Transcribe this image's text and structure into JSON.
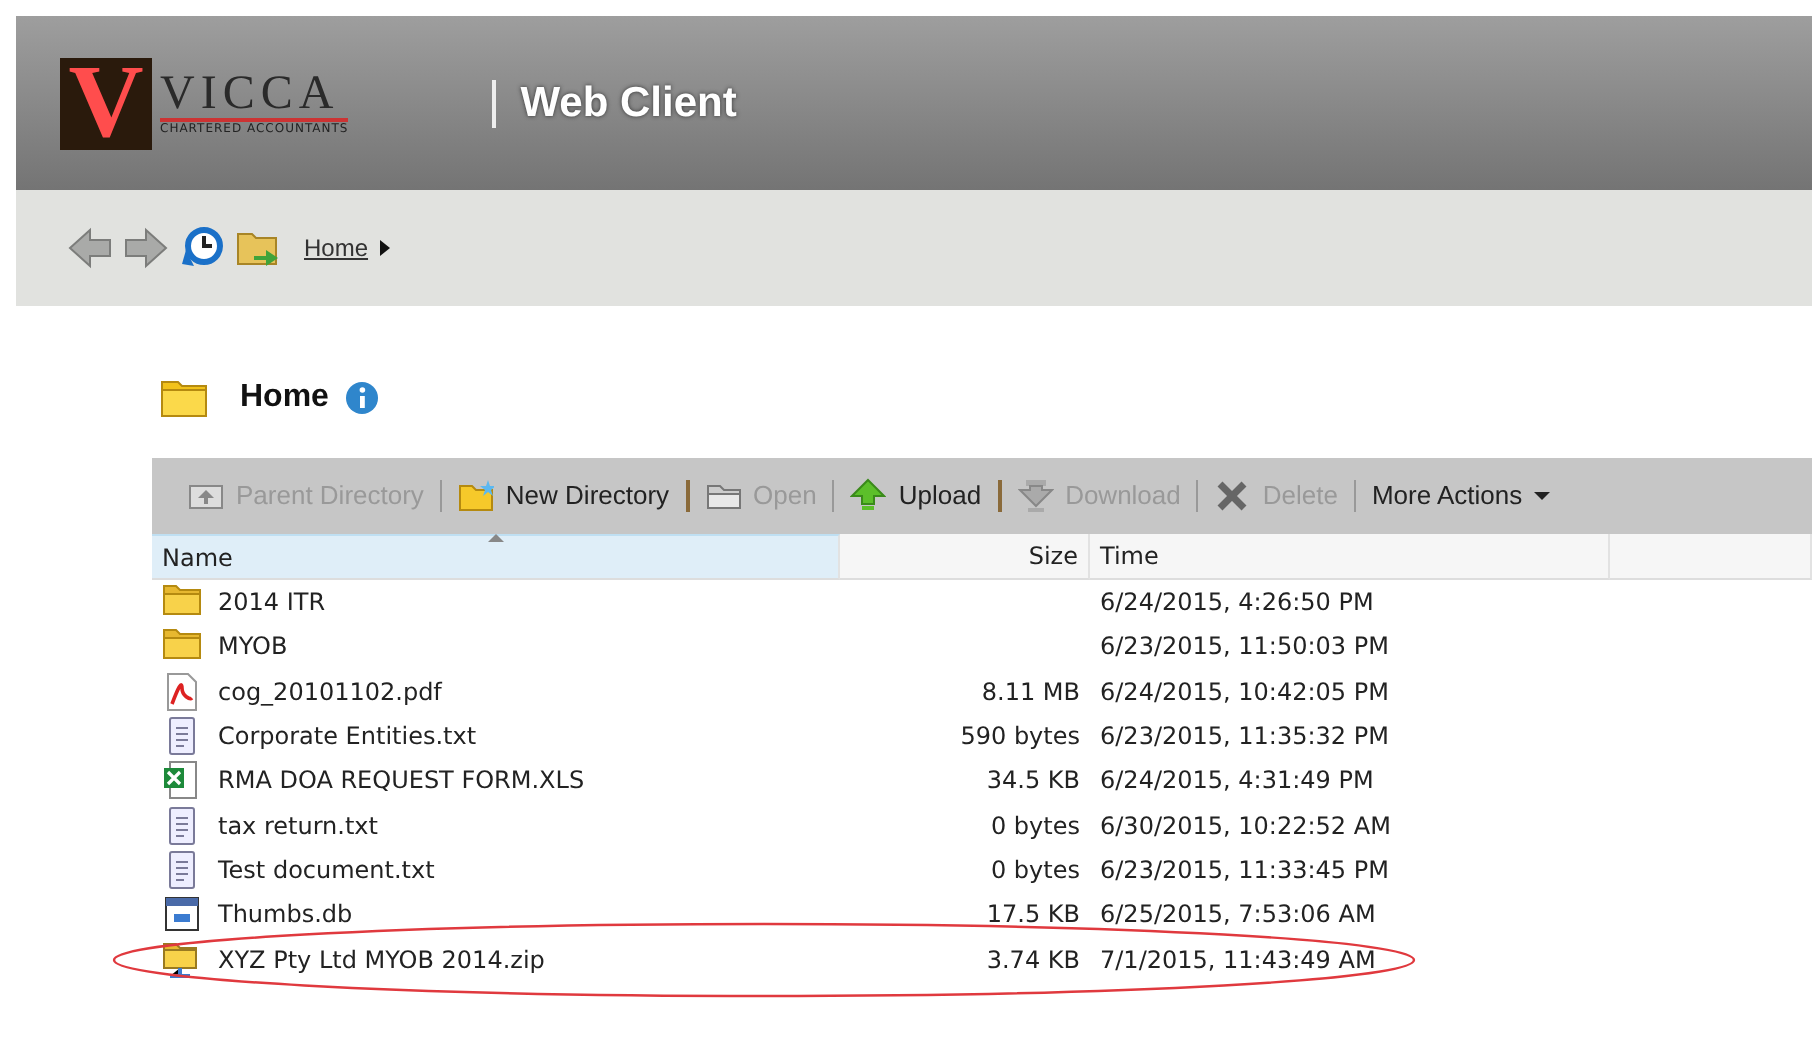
{
  "logo": {
    "mark": "V",
    "name": "VICCA",
    "tagline": "CHARTERED ACCOUNTANTS"
  },
  "app_title": "Web Client",
  "nav": {
    "buttons": [
      {
        "kind": "back"
      },
      {
        "kind": "forward"
      },
      {
        "kind": "history"
      },
      {
        "kind": "folder-go"
      }
    ],
    "breadcrumb": [
      "Home"
    ]
  },
  "folder_title": "Home",
  "toolbar": [
    {
      "kind": "parent",
      "label": "Parent Directory",
      "disabled": true
    },
    {
      "kind": "new-dir",
      "label": "New Directory",
      "disabled": false
    },
    {
      "kind": "open",
      "label": "Open",
      "disabled": true
    },
    {
      "kind": "upload",
      "label": "Upload",
      "disabled": false
    },
    {
      "kind": "download",
      "label": "Download",
      "disabled": true
    },
    {
      "kind": "delete",
      "label": "Delete",
      "disabled": true
    },
    {
      "kind": "menu",
      "label": "More Actions",
      "disabled": false
    }
  ],
  "table": {
    "columns": [
      {
        "label": "Name",
        "sorted": true
      },
      {
        "label": "Size",
        "sorted": false
      },
      {
        "label": "Time",
        "sorted": false
      }
    ],
    "rows": [
      {
        "kind": "folder",
        "name": "2014 ITR",
        "size": "",
        "time": "6/24/2015, 4:26:50 PM",
        "highlighted": false
      },
      {
        "kind": "folder",
        "name": "MYOB",
        "size": "",
        "time": "6/23/2015, 11:50:03 PM",
        "highlighted": false
      },
      {
        "kind": "pdf",
        "name": "cog_20101102.pdf",
        "size": "8.11 MB",
        "time": "6/24/2015, 10:42:05 PM",
        "highlighted": false
      },
      {
        "kind": "txt",
        "name": "Corporate Entities.txt",
        "size": "590 bytes",
        "time": "6/23/2015, 11:35:32 PM",
        "highlighted": false
      },
      {
        "kind": "xls",
        "name": "RMA DOA REQUEST FORM.XLS",
        "size": "34.5 KB",
        "time": "6/24/2015, 4:31:49 PM",
        "highlighted": false
      },
      {
        "kind": "txt",
        "name": "tax return.txt",
        "size": "0 bytes",
        "time": "6/30/2015, 10:22:52 AM",
        "highlighted": false
      },
      {
        "kind": "txt",
        "name": "Test document.txt",
        "size": "0 bytes",
        "time": "6/23/2015, 11:33:45 PM",
        "highlighted": false
      },
      {
        "kind": "db",
        "name": "Thumbs.db",
        "size": "17.5 KB",
        "time": "6/25/2015, 7:53:06 AM",
        "highlighted": false
      },
      {
        "kind": "zip",
        "name": "XYZ Pty Ltd MYOB 2014.zip",
        "size": "3.74 KB",
        "time": "7/1/2015, 11:43:49 AM",
        "highlighted": true
      }
    ]
  }
}
